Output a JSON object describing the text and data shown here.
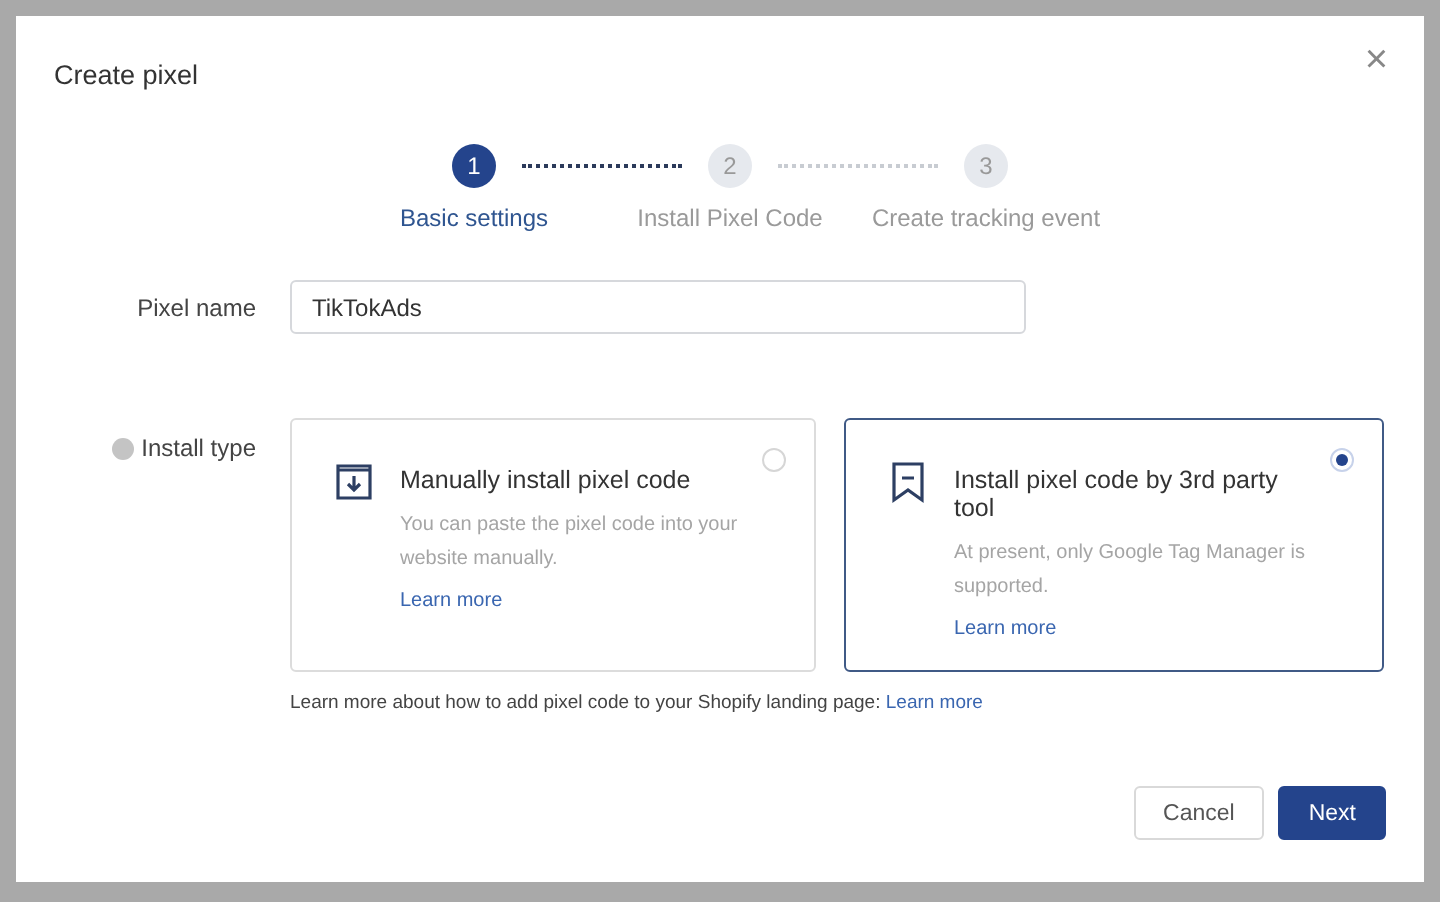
{
  "dialog": {
    "title": "Create pixel",
    "close": "×"
  },
  "steps": [
    {
      "number": "1",
      "label": "Basic settings",
      "selected": true
    },
    {
      "number": "2",
      "label": "Install Pixel Code",
      "selected": false
    },
    {
      "number": "3",
      "label": "Create tracking event",
      "selected": false
    }
  ],
  "pixel_name": {
    "label": "Pixel name",
    "value": "TikTokAds"
  },
  "install_type": {
    "label": "Install type",
    "options": [
      {
        "kind": "download",
        "title": "Manually install pixel code",
        "description": "You can paste the pixel code into your website manually.",
        "link": "Learn more",
        "selected": false
      },
      {
        "kind": "bookmark",
        "title": "Install pixel code by 3rd party tool",
        "description": "At present, only Google Tag Manager is supported.",
        "link": "Learn more",
        "selected": true
      }
    ]
  },
  "help_text": {
    "text": "Learn more about how to add pixel code to your Shopify landing page:",
    "link": "Learn more"
  },
  "buttons": [
    {
      "label": "Cancel",
      "kind": "secondary"
    },
    {
      "label": "Next",
      "kind": "primary"
    }
  ]
}
